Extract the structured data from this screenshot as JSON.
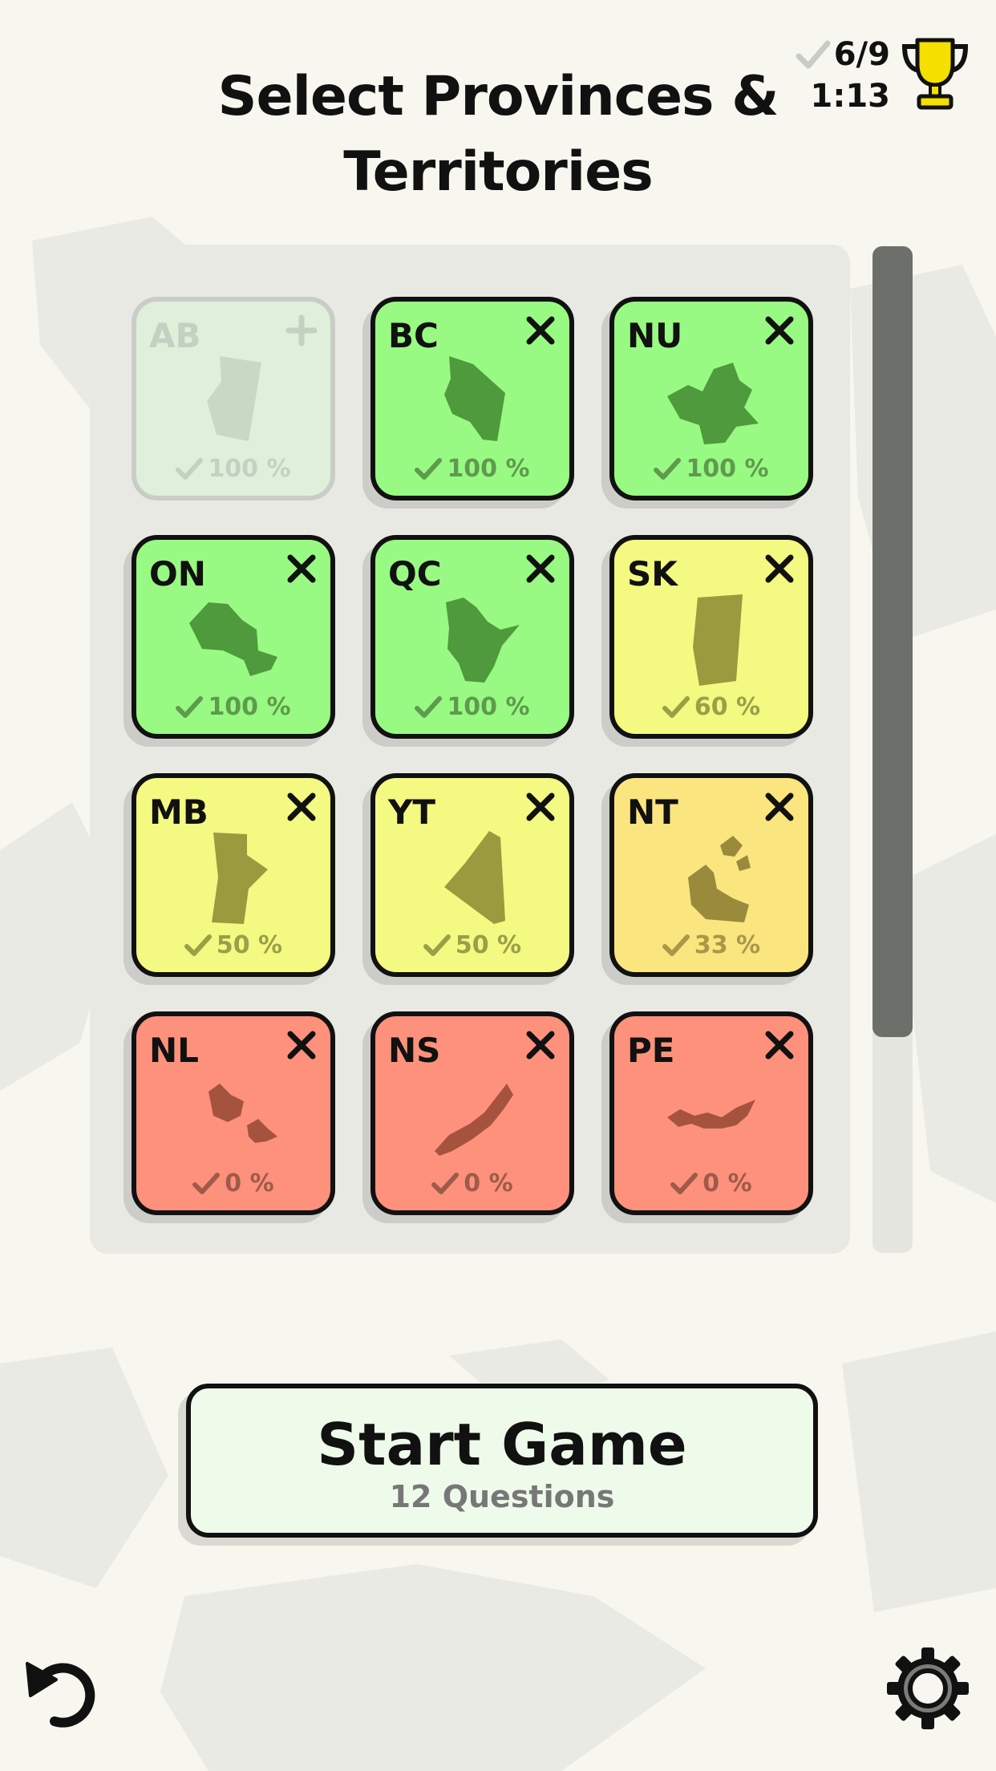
{
  "title": "Select Provinces & Territories",
  "stats": {
    "score": "6/9",
    "timer": "1:13"
  },
  "colors": {
    "green": "#98fa82",
    "yellow": "#f3f981",
    "orange": "#fbe57e",
    "red": "#fd917c",
    "disabled": "#dff0da"
  },
  "tiles": [
    {
      "code": "AB",
      "percent": "100 %",
      "state": "disabled",
      "action": "add"
    },
    {
      "code": "BC",
      "percent": "100 %",
      "state": "green",
      "action": "remove"
    },
    {
      "code": "NU",
      "percent": "100 %",
      "state": "green",
      "action": "remove"
    },
    {
      "code": "ON",
      "percent": "100 %",
      "state": "green",
      "action": "remove"
    },
    {
      "code": "QC",
      "percent": "100 %",
      "state": "green",
      "action": "remove"
    },
    {
      "code": "SK",
      "percent": "60 %",
      "state": "yellow",
      "action": "remove"
    },
    {
      "code": "MB",
      "percent": "50 %",
      "state": "yellow",
      "action": "remove"
    },
    {
      "code": "YT",
      "percent": "50 %",
      "state": "yellow",
      "action": "remove"
    },
    {
      "code": "NT",
      "percent": "33 %",
      "state": "orange",
      "action": "remove"
    },
    {
      "code": "NL",
      "percent": "0 %",
      "state": "red",
      "action": "remove"
    },
    {
      "code": "NS",
      "percent": "0 %",
      "state": "red",
      "action": "remove"
    },
    {
      "code": "PE",
      "percent": "0 %",
      "state": "red",
      "action": "remove"
    }
  ],
  "start_button": {
    "label": "Start Game",
    "sublabel": "12 Questions"
  },
  "icons": {
    "undo": "undo-icon",
    "settings": "gear-icon",
    "trophy": "trophy-icon"
  }
}
